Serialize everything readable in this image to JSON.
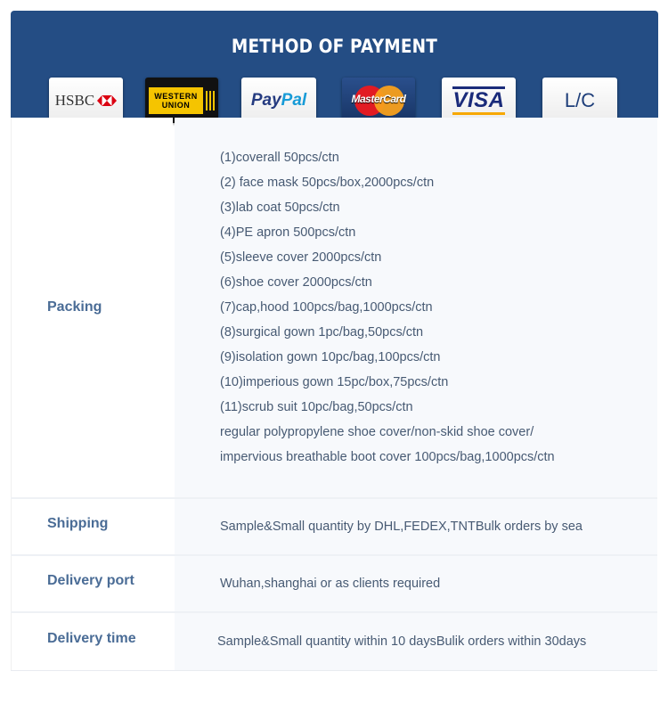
{
  "header": {
    "title": "METHOD OF PAYMENT"
  },
  "payment_methods": {
    "hsbc": "HSBC",
    "western_union_line1": "WESTERN",
    "western_union_line2": "UNION",
    "paypal_a": "Pay",
    "paypal_b": "Pal",
    "mastercard": "MasterCard",
    "visa": "VISA",
    "lc": "L/C"
  },
  "rows": {
    "packing": {
      "label": "Packing",
      "items": [
        "(1)coverall 50pcs/ctn",
        "(2) face mask 50pcs/box,2000pcs/ctn",
        "(3)lab coat 50pcs/ctn",
        "(4)PE apron 500pcs/ctn",
        "(5)sleeve cover 2000pcs/ctn",
        "(6)shoe cover 2000pcs/ctn",
        "(7)cap,hood 100pcs/bag,1000pcs/ctn",
        "(8)surgical gown 1pc/bag,50pcs/ctn",
        "(9)isolation gown 10pc/bag,100pcs/ctn",
        "(10)imperious gown 15pc/box,75pcs/ctn",
        "(11)scrub suit 10pc/bag,50pcs/ctn",
        "regular polypropylene shoe cover/non-skid shoe cover/",
        "impervious breathable boot cover 100pcs/bag,1000pcs/ctn"
      ]
    },
    "shipping": {
      "label": "Shipping",
      "value": "Sample&Small quantity by DHL,FEDEX,TNTBulk orders by sea"
    },
    "delivery_port": {
      "label": "Delivery port",
      "value": "Wuhan,shanghai or as clients required"
    },
    "delivery_time": {
      "label": "Delivery time",
      "value": "Sample&Small quantity within 10 daysBulik orders within 30days"
    }
  }
}
